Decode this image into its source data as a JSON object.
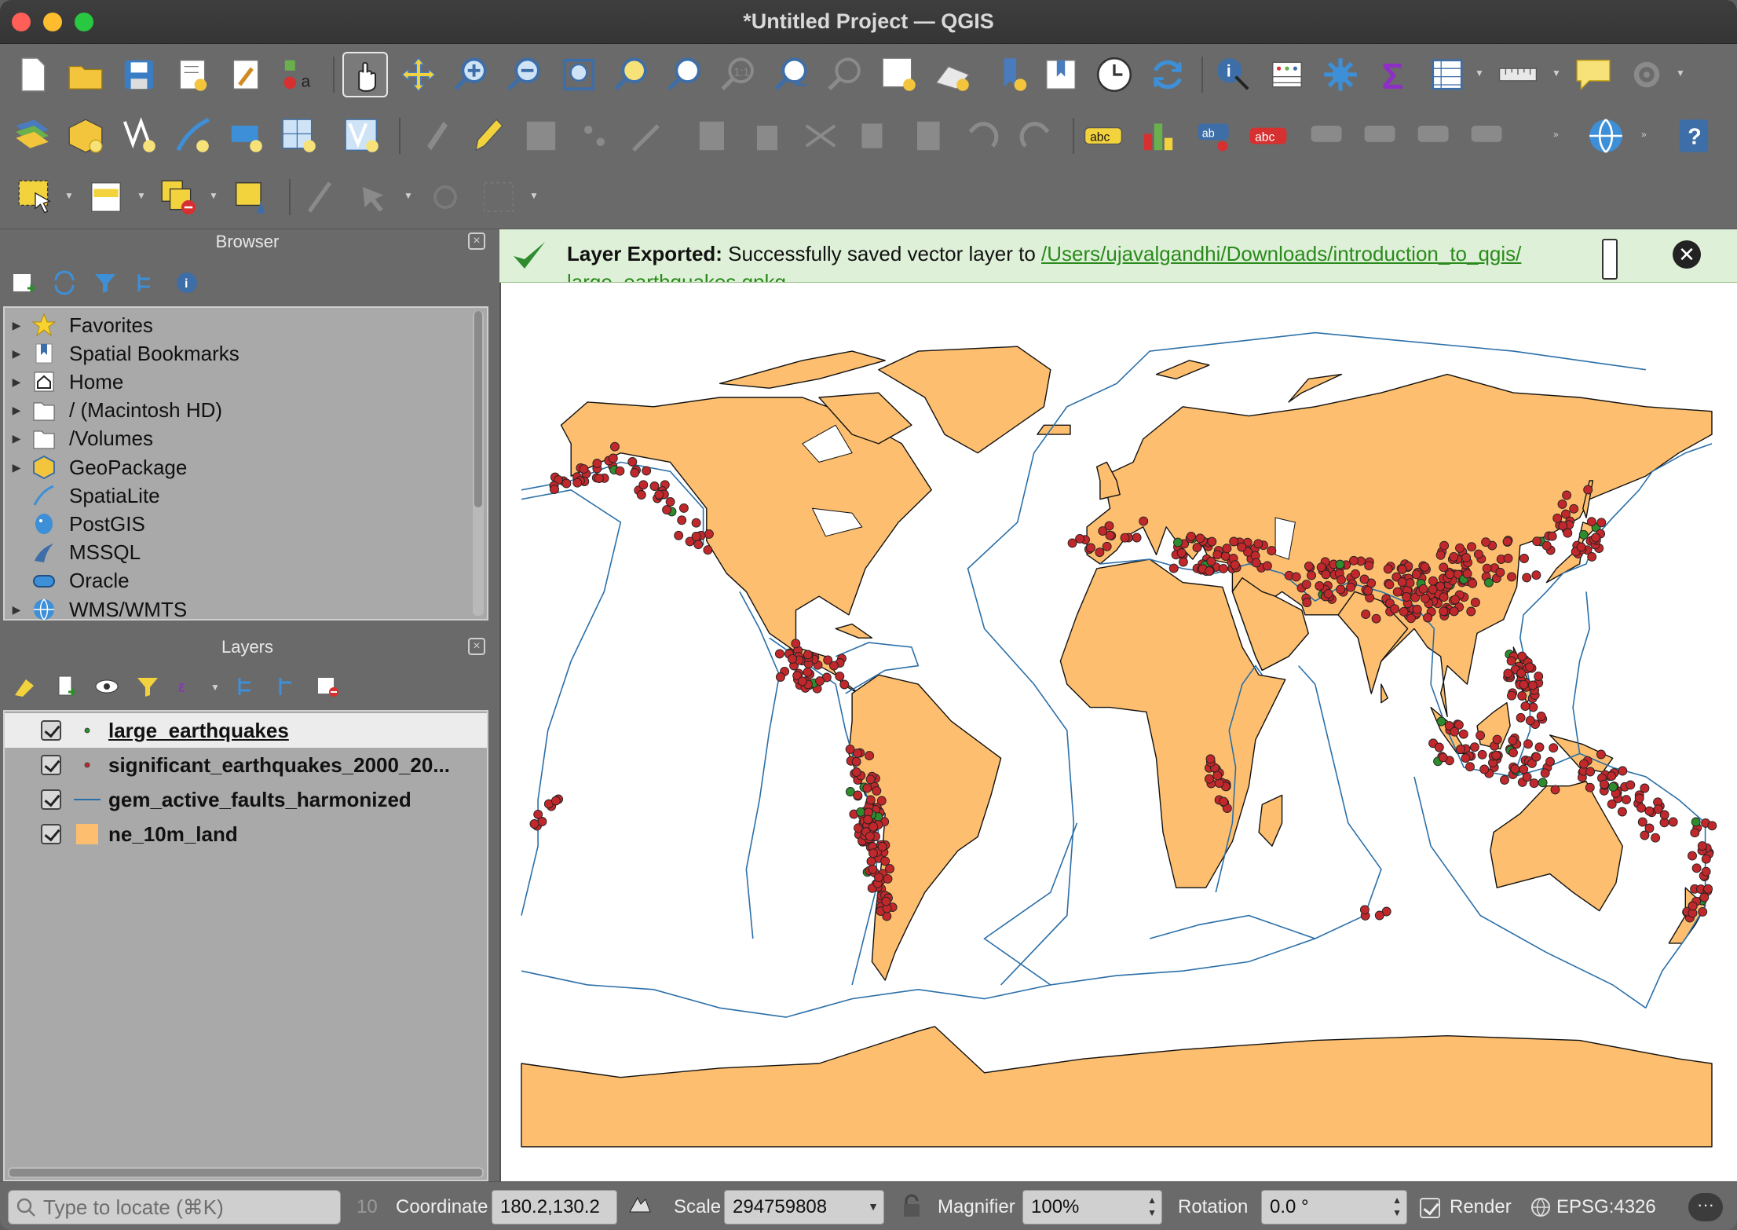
{
  "window": {
    "title": "*Untitled Project — QGIS"
  },
  "browser": {
    "title": "Browser",
    "items": [
      {
        "label": "Favorites",
        "icon": "star-icon",
        "expandable": true
      },
      {
        "label": "Spatial Bookmarks",
        "icon": "bookmark-icon",
        "expandable": true
      },
      {
        "label": "Home",
        "icon": "home-icon",
        "expandable": true
      },
      {
        "label": "/ (Macintosh HD)",
        "icon": "folder-icon",
        "expandable": true
      },
      {
        "label": "/Volumes",
        "icon": "folder-icon",
        "expandable": true
      },
      {
        "label": "GeoPackage",
        "icon": "geopackage-icon",
        "expandable": true
      },
      {
        "label": "SpatiaLite",
        "icon": "spatialite-icon",
        "expandable": false
      },
      {
        "label": "PostGIS",
        "icon": "postgis-icon",
        "expandable": false
      },
      {
        "label": "MSSQL",
        "icon": "mssql-icon",
        "expandable": false
      },
      {
        "label": "Oracle",
        "icon": "oracle-icon",
        "expandable": false
      },
      {
        "label": "WMS/WMTS",
        "icon": "globe-icon",
        "expandable": true
      }
    ]
  },
  "layers": {
    "title": "Layers",
    "items": [
      {
        "name": "large_earthquakes",
        "symbol": "point",
        "color": "#2e8b2e",
        "checked": true,
        "selected": true
      },
      {
        "name": "significant_earthquakes_2000_20...",
        "symbol": "point",
        "color": "#c0282c",
        "checked": true,
        "selected": false
      },
      {
        "name": "gem_active_faults_harmonized",
        "symbol": "line",
        "color": "#2b6fa8",
        "checked": true,
        "selected": false
      },
      {
        "name": "ne_10m_land",
        "symbol": "polygon",
        "color": "#fdbf6f",
        "checked": true,
        "selected": false
      }
    ]
  },
  "message": {
    "title": "Layer Exported:",
    "text": " Successfully saved vector layer to ",
    "link": "/Users/ujavalgandhi/Downloads/introduction_to_qgis/",
    "link_cont": "large_earthquakes.gpkg",
    "close": "✕"
  },
  "status": {
    "locator_placeholder": "Type to locate (⌘K)",
    "count": "10",
    "coordinate_label": "Coordinate",
    "coordinate_value": "180.2,130.2",
    "scale_label": "Scale",
    "scale_value": "294759808",
    "magnifier_label": "Magnifier",
    "magnifier_value": "100%",
    "rotation_label": "Rotation",
    "rotation_value": "0.0 °",
    "render_label": "Render",
    "crs": "EPSG:4326"
  },
  "colors": {
    "land": "#fdbf6f",
    "faults": "#2b6fa8",
    "significant": "#c0282c",
    "large": "#2e8b2e",
    "message_bg": "#dff0d8"
  }
}
